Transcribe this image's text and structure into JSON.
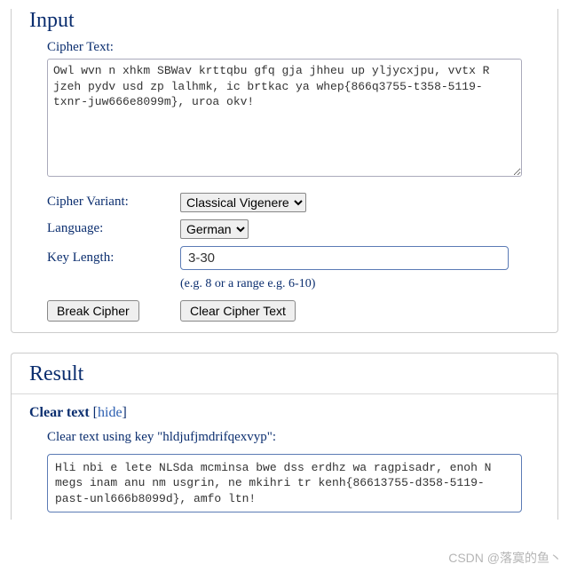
{
  "input": {
    "heading": "Input",
    "cipher_text_label": "Cipher Text:",
    "cipher_text_value": "Owl wvn n xhkm SBWav krttqbu gfq gja jhheu up yljycxjpu, vvtx R jzeh pydv usd zp lalhmk, ic brtkac ya whep{866q3755-t358-5119-txnr-juw666e8099m}, uroa okv!",
    "variant_label": "Cipher Variant:",
    "variant_selected": "Classical Vigenere",
    "language_label": "Language:",
    "language_selected": "German",
    "key_length_label": "Key Length:",
    "key_length_value": "3-30",
    "key_length_hint": "(e.g. 8 or a range e.g. 6-10)",
    "break_button": "Break Cipher",
    "clear_button": "Clear Cipher Text"
  },
  "result": {
    "heading": "Result",
    "lead_bold": "Clear text",
    "lead_link": "hide",
    "key_line": "Clear text using key \"hldjufjmdrifqexvyp\":",
    "clear_text": "Hli nbi e lete NLSda mcminsa bwe dss erdhz wa ragpisadr, enoh N megs inam anu nm usgrin, ne mkihri tr kenh{86613755-d358-5119-past-unl666b8099d}, amfo ltn!"
  },
  "watermark": "CSDN @落寞的鱼丶"
}
